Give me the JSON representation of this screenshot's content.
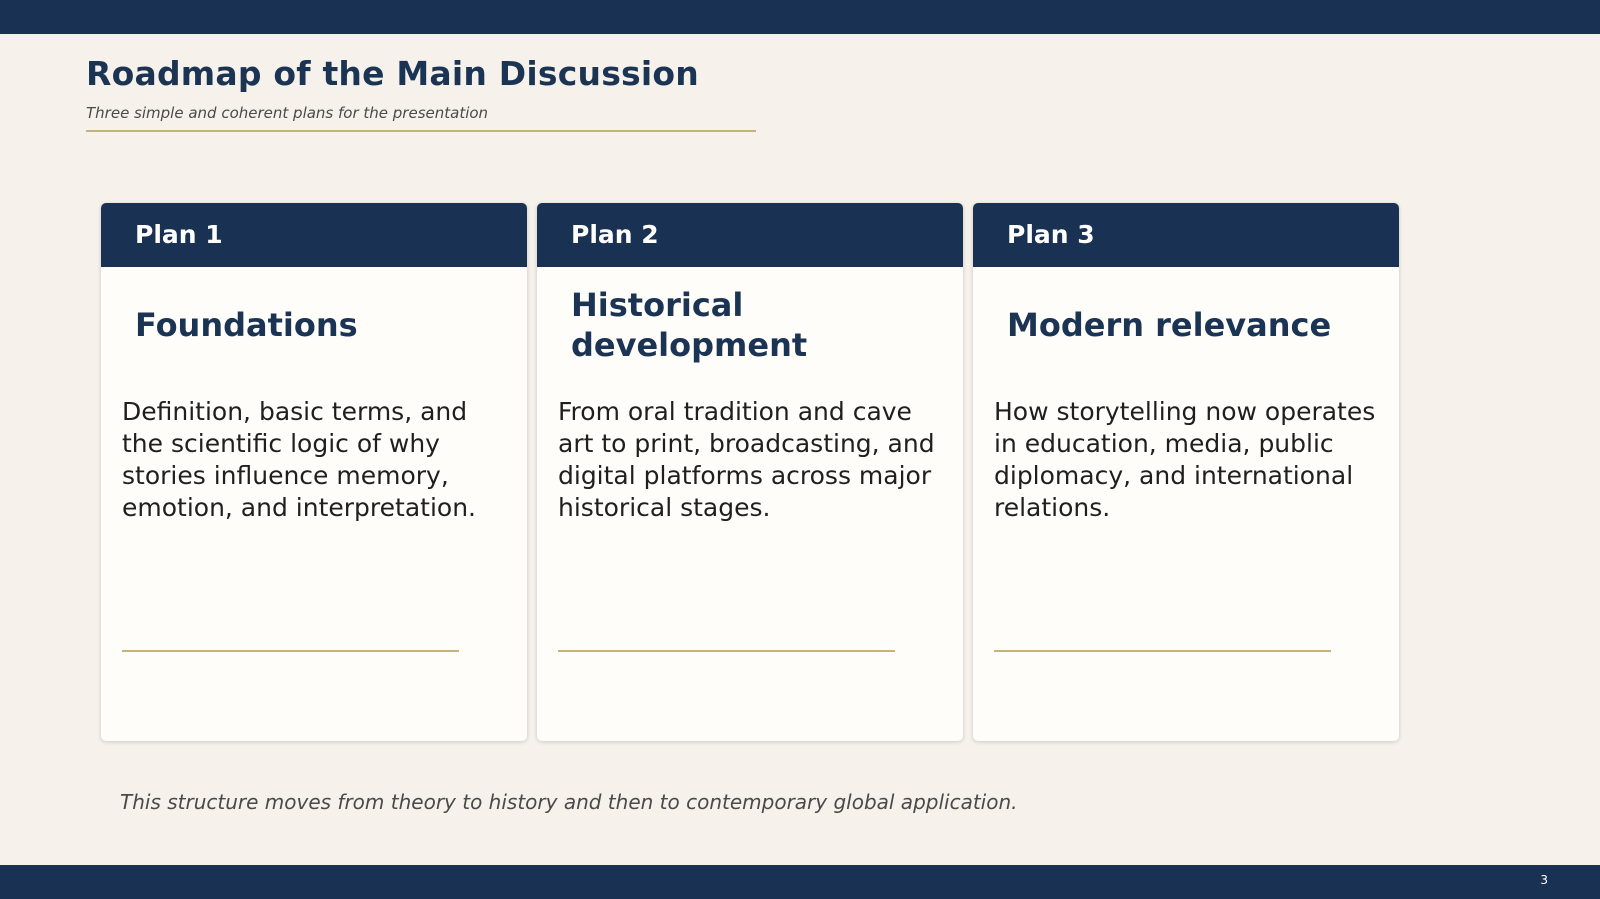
{
  "slide": {
    "title": "Roadmap of the Main Discussion",
    "subtitle": "Three simple and coherent plans for the presentation",
    "footer_note": "This structure moves from theory to history and then to contemporary global application.",
    "page_number": "3"
  },
  "cards": [
    {
      "label": "Plan 1",
      "heading": "Foundations",
      "body": "Definition, basic terms, and the scientific logic of why stories influence memory, emotion, and interpretation."
    },
    {
      "label": "Plan 2",
      "heading": "Historical development",
      "body": "From oral tradition and cave art to print, broadcasting, and digital platforms across major historical stages."
    },
    {
      "label": "Plan 3",
      "heading": "Modern relevance",
      "body": "How storytelling now operates in education, media, public diplomacy, and international relations."
    }
  ],
  "colors": {
    "navy": "#193253",
    "gold_rule": "#c7b27a",
    "background": "#f6f2eb",
    "card": "#fffdf9"
  }
}
